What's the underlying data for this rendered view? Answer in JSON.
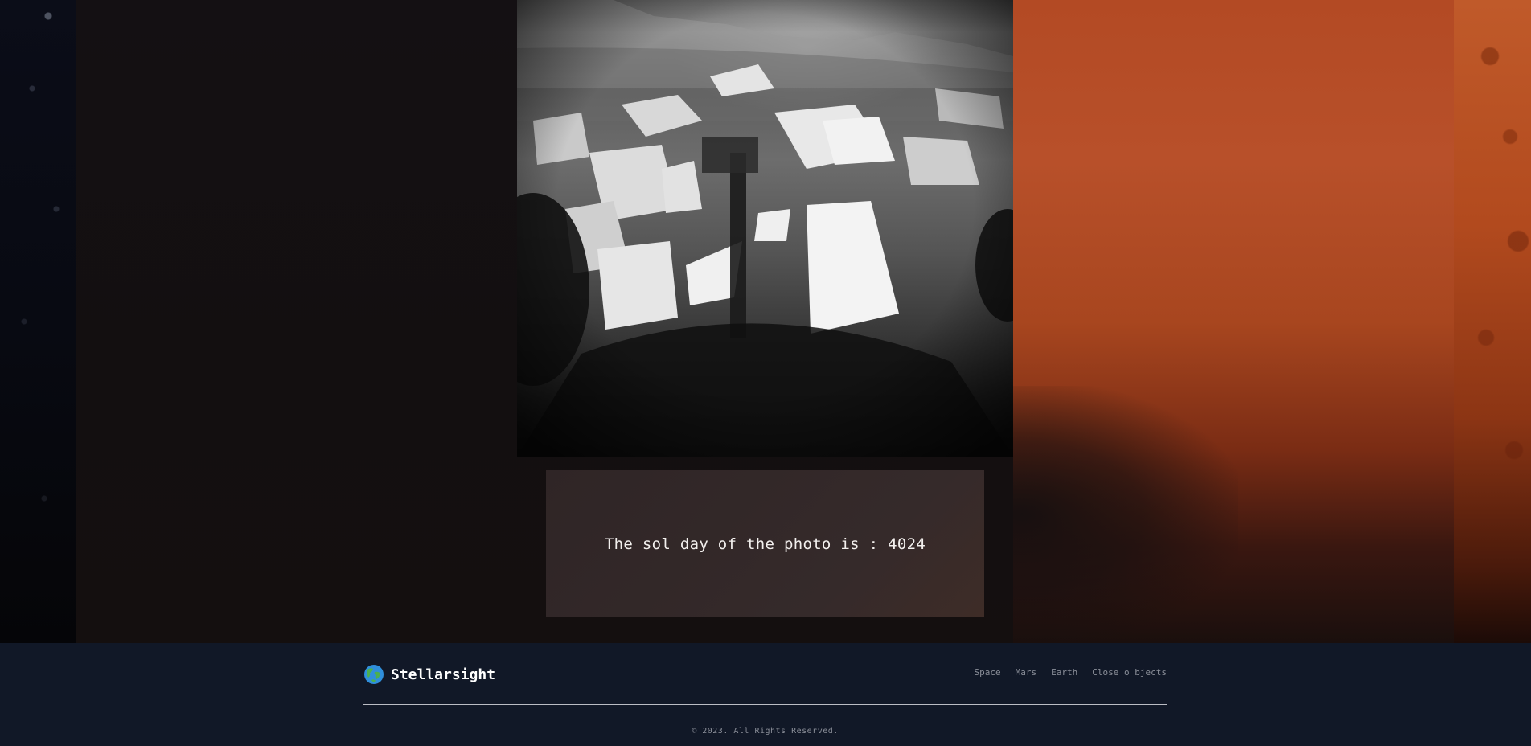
{
  "photo": {
    "sol_text": "The sol day of the photo is : 4024"
  },
  "footer": {
    "brand": {
      "icon": "earth-globe-icon",
      "name": "Stellarsight"
    },
    "nav": [
      {
        "label": "Space"
      },
      {
        "label": "Mars"
      },
      {
        "label": "Earth"
      },
      {
        "label": "Close o bjects"
      }
    ],
    "copyright": "© 2023. All Rights Reserved."
  },
  "colors": {
    "footer_bg": "#111827",
    "caption_bg": "#352a2a",
    "mars_orange": "#b8502a"
  }
}
